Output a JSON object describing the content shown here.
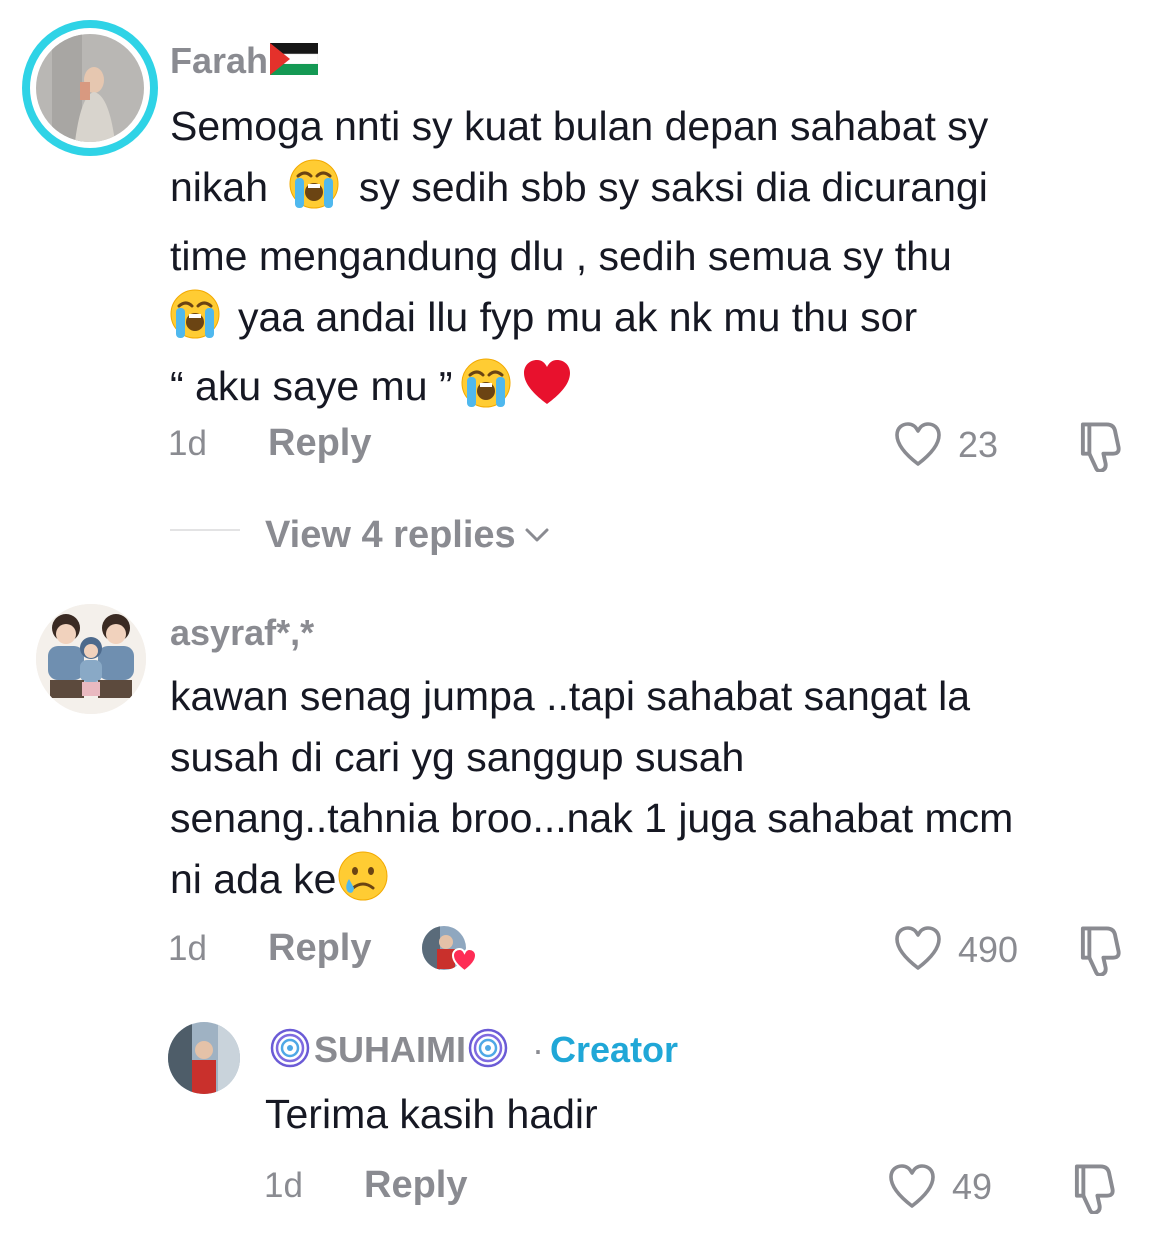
{
  "comments": [
    {
      "username": "Farah",
      "text_lines": [
        "Semoga nnti sy kuat bulan depan sahabat sy",
        "nikah",
        "sy sedih sbb sy saksi dia dicurangi",
        "time mengandung dlu , sedih semua sy thu",
        "yaa andai llu fyp mu ak nk mu thu sor",
        "“ aku saye mu ”"
      ],
      "age": "1d",
      "reply_label": "Reply",
      "likes": "23",
      "view_replies": "View 4 replies"
    },
    {
      "username": "asyraf*,*",
      "text_lines": [
        "kawan senag jumpa ..tapi sahabat sangat la",
        "susah di cari yg sanggup susah",
        "senang..tahnia broo...nak 1 juga sahabat mcm",
        "ni ada ke"
      ],
      "age": "1d",
      "reply_label": "Reply",
      "likes": "490"
    }
  ],
  "reply": {
    "username": "SUHAIMI",
    "separator": "·",
    "badge": "Creator",
    "text": "Terima kasih hadir",
    "age": "1d",
    "reply_label": "Reply",
    "likes": "49"
  },
  "icons": [
    "flag-palestine-icon",
    "loudly-crying-face-icon",
    "red-heart-icon",
    "crying-face-icon",
    "heart-outline-icon",
    "thumbs-down-icon",
    "chevron-down-icon",
    "fingerprint-icon",
    "creator-liked-heart-icon"
  ],
  "colors": {
    "text": "#161823",
    "muted": "#8a8b91",
    "creator": "#20a7d7",
    "story_ring": "#2fd3e6",
    "heart": "#fe2c55"
  }
}
